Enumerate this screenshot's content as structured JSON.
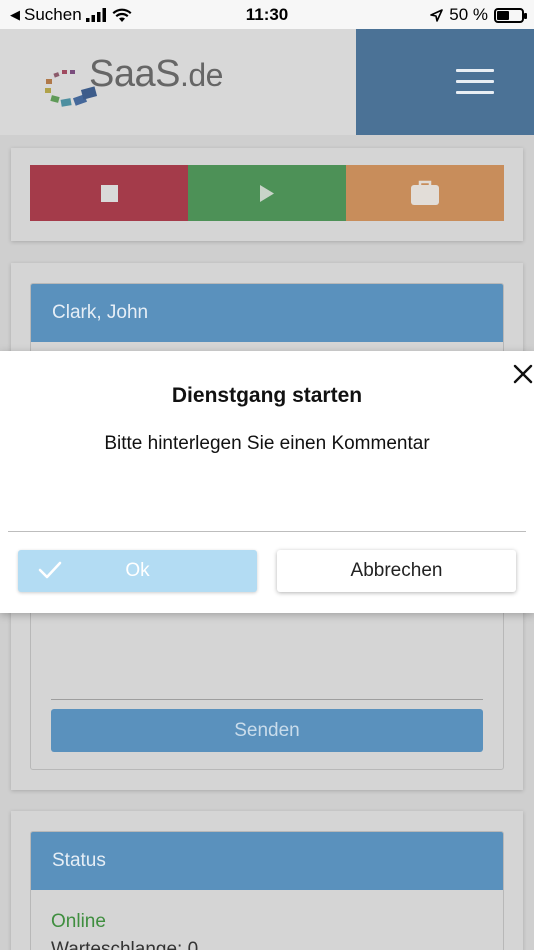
{
  "status_bar": {
    "back_label": "Suchen",
    "time": "11:30",
    "battery": "50 %"
  },
  "header": {
    "logo_main": "SaaS",
    "logo_suffix": ".de"
  },
  "user_card": {
    "name": "Clark, John",
    "send_label": "Senden"
  },
  "status_card": {
    "title": "Status",
    "online": "Online",
    "queue": "Warteschlange: 0"
  },
  "modal": {
    "title": "Dienstgang starten",
    "message": "Bitte hinterlegen Sie einen Kommentar",
    "ok_label": "Ok",
    "cancel_label": "Abbrechen"
  },
  "colors": {
    "stop": "#a43b4a",
    "play": "#4d9157",
    "briefcase": "#c88d5b",
    "header_blue": "#4b7296",
    "bar_blue": "#5a91bd",
    "ok_button": "#b3dcf3",
    "online_green": "#3f8e3f"
  },
  "icons": [
    "back-arrow-icon",
    "signal-icon",
    "wifi-icon",
    "location-icon",
    "battery-icon",
    "hamburger-icon",
    "stop-icon",
    "play-icon",
    "briefcase-icon",
    "close-icon",
    "check-icon"
  ]
}
